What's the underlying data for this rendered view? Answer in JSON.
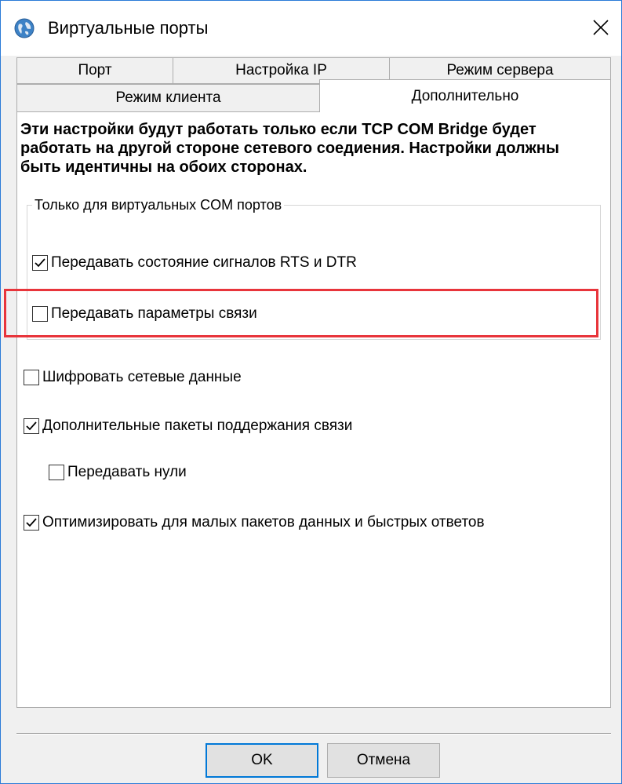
{
  "window": {
    "title": "Виртуальные порты",
    "icon": "app-globe-icon",
    "close_glyph": "✕"
  },
  "tabs": {
    "row1": [
      {
        "label": "Порт"
      },
      {
        "label": "Настройка IP"
      },
      {
        "label": "Режим сервера"
      }
    ],
    "row2": [
      {
        "label": "Режим клиента"
      },
      {
        "label": "Дополнительно",
        "active": true
      }
    ]
  },
  "panel": {
    "info_text": "Эти настройки будут работать только если TCP COM Bridge будет работать на другой стороне сетевого соедиения. Настройки должны быть идентичны на обоих сторонах.",
    "group": {
      "title": "Только для виртуальных COM портов",
      "options": [
        {
          "label": "Передавать состояние сигналов RTS и DTR",
          "checked": true
        },
        {
          "label": "Передавать параметры связи",
          "checked": false
        }
      ]
    },
    "options": [
      {
        "label": "Шифровать сетевые данные",
        "checked": false
      },
      {
        "label": "Дополнительные пакеты поддержания связи",
        "checked": true
      },
      {
        "label": "Передавать нули",
        "checked": false
      },
      {
        "label": "Оптимизировать для малых пакетов данных и быстрых ответов",
        "checked": true
      }
    ]
  },
  "buttons": {
    "ok": "OK",
    "cancel": "Отмена"
  },
  "colors": {
    "highlight": "#e8353b",
    "accent": "#0078d7",
    "window_border": "#2b7bd8"
  }
}
